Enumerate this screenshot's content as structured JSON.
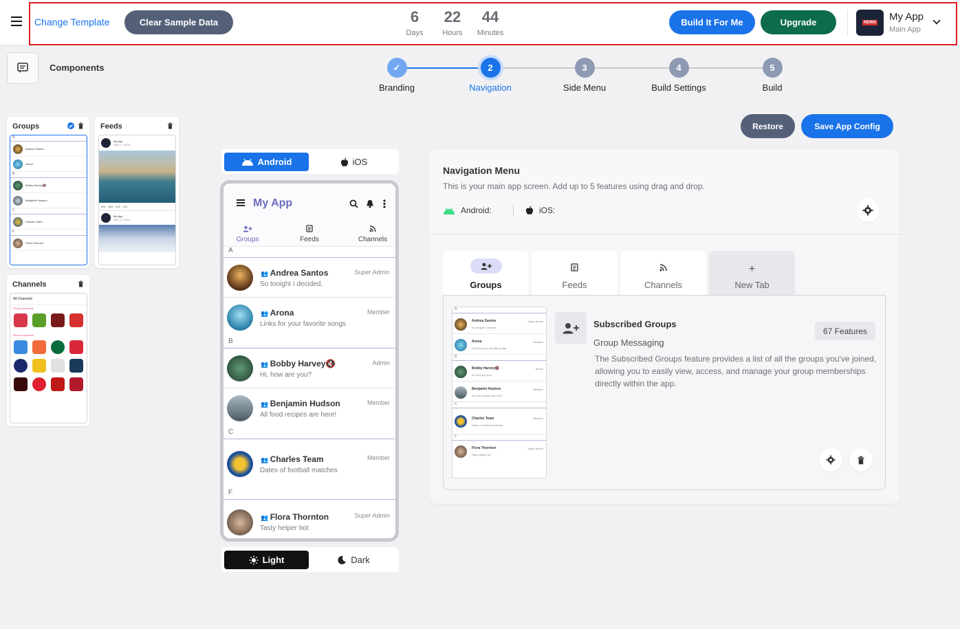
{
  "header": {
    "change_template": "Change Template",
    "clear_sample": "Clear Sample Data",
    "countdown": [
      {
        "value": "6",
        "unit": "Days"
      },
      {
        "value": "22",
        "unit": "Hours"
      },
      {
        "value": "44",
        "unit": "Minutes"
      }
    ],
    "build_label": "Build It For Me",
    "upgrade_label": "Upgrade",
    "app_name": "My App",
    "app_subtitle": "Main App",
    "logo_text": "NEWS"
  },
  "components": {
    "title": "Components"
  },
  "stepper": [
    {
      "num": "✓",
      "label": "Branding",
      "state": "done"
    },
    {
      "num": "2",
      "label": "Navigation",
      "state": "active"
    },
    {
      "num": "3",
      "label": "Side Menu",
      "state": "pending"
    },
    {
      "num": "4",
      "label": "Build Settings",
      "state": "pending"
    },
    {
      "num": "5",
      "label": "Build",
      "state": "pending"
    }
  ],
  "cards": {
    "groups": "Groups",
    "feeds": "Feeds",
    "channels": "Channels",
    "feed_author": "My App",
    "feed_date": "Sep 17, 2025",
    "feed_stats": [
      "29k",
      "653",
      "42k",
      "124"
    ],
    "channels_header": "All Channels",
    "pinned_label": "Pinned channels",
    "recent_label": "Recent channels"
  },
  "os_toggle": {
    "android": "Android",
    "ios": "iOS"
  },
  "phone": {
    "title": "My App",
    "tabs": [
      "Groups",
      "Feeds",
      "Channels"
    ],
    "sections": [
      {
        "letter": "A",
        "rows": [
          {
            "name": "Andrea Santos",
            "sub": "So tonight I decided.",
            "role": "Super Admin"
          },
          {
            "name": "Arona",
            "sub": "Links for your favorite songs",
            "role": "Member"
          }
        ]
      },
      {
        "letter": "B",
        "rows": [
          {
            "name": "Bobby Harvey🔇",
            "sub": "Hi, how are you?",
            "role": "Admin"
          },
          {
            "name": "Benjamin Hudson",
            "sub": "All food recipes are here!",
            "role": "Member"
          }
        ]
      },
      {
        "letter": "C",
        "rows": [
          {
            "name": "Charles Team",
            "sub": "Dates of football matches",
            "role": "Member"
          }
        ]
      },
      {
        "letter": "F",
        "rows": [
          {
            "name": "Flora Thornton",
            "sub": "Tasty helper bot",
            "role": "Super Admin"
          }
        ]
      }
    ]
  },
  "theme_toggle": {
    "light": "Light",
    "dark": "Dark"
  },
  "actions": {
    "restore": "Restore",
    "save": "Save App Config"
  },
  "panel": {
    "title": "Navigation Menu",
    "desc": "This is your main app screen. Add up to 5 features using drag and drop.",
    "android": "Android:",
    "ios": "iOS:",
    "tabs": [
      {
        "label": "Groups"
      },
      {
        "label": "Feeds"
      },
      {
        "label": "Channels"
      },
      {
        "label": "New Tab"
      }
    ],
    "feature": {
      "title": "Subscribed Groups",
      "subtitle": "Group Messaging",
      "badge": "67 Features",
      "desc": "The Subscribed Groups feature provides a list of all the groups you've joined, allowing you to easily view, access, and manage your group memberships directly within the app."
    }
  },
  "colors": {
    "primary": "#1a73e8",
    "slate_button": "#546078",
    "upgrade": "#0d6b4e",
    "outline": "#e01b24"
  }
}
